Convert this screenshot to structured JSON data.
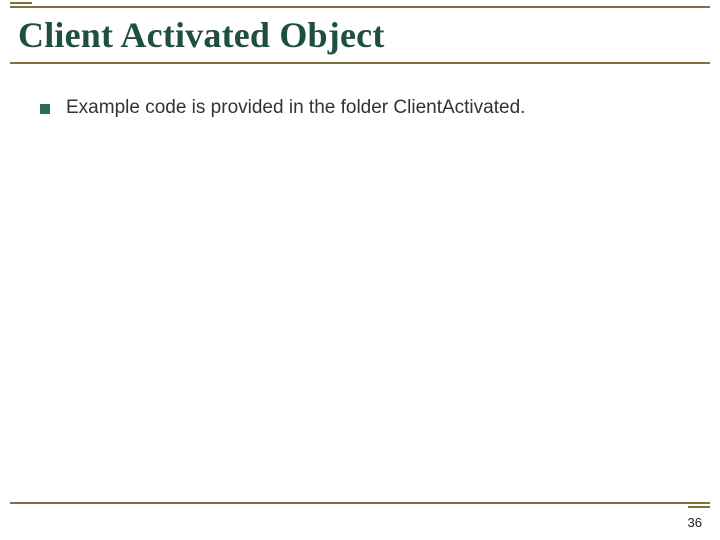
{
  "slide": {
    "title": "Client Activated Object",
    "bullets": [
      {
        "text": "Example code is provided in the folder ClientActivated."
      }
    ],
    "page_number": "36"
  },
  "colors": {
    "accent_line": "#807040",
    "title": "#1f4f3e",
    "bullet": "#2f6b50"
  }
}
